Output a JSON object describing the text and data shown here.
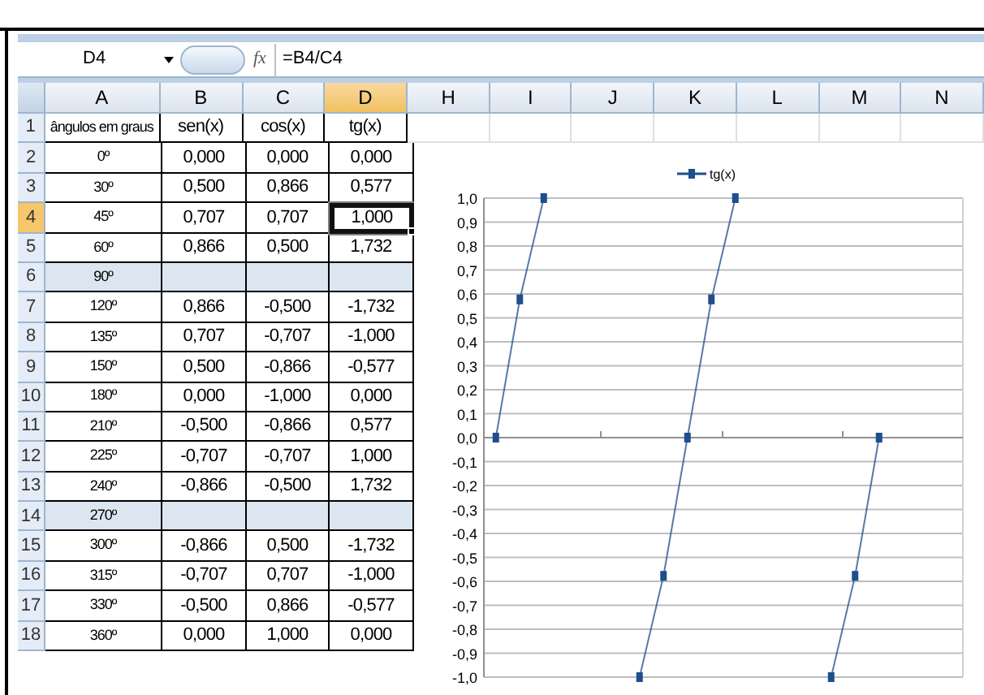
{
  "name_box": "D4",
  "fx_label": "fx",
  "formula": "=B4/C4",
  "columns": [
    {
      "label": "A",
      "selected": false
    },
    {
      "label": "B",
      "selected": false
    },
    {
      "label": "C",
      "selected": false
    },
    {
      "label": "D",
      "selected": true
    },
    {
      "label": "H",
      "selected": false
    },
    {
      "label": "I",
      "selected": false
    },
    {
      "label": "J",
      "selected": false
    },
    {
      "label": "K",
      "selected": false
    },
    {
      "label": "L",
      "selected": false
    },
    {
      "label": "M",
      "selected": false
    },
    {
      "label": "N",
      "selected": false
    }
  ],
  "rows": [
    {
      "number": "1",
      "selected": false,
      "shaded": false,
      "cells": [
        {
          "text": "ângulos em graus",
          "selected": false
        },
        {
          "text": "sen(x)",
          "selected": false
        },
        {
          "text": "cos(x)",
          "selected": false
        },
        {
          "text": "tg(x)",
          "selected": false
        }
      ]
    },
    {
      "number": "2",
      "selected": false,
      "shaded": false,
      "cells": [
        {
          "text": "0º",
          "selected": false
        },
        {
          "text": "0,000",
          "selected": false
        },
        {
          "text": "0,000",
          "selected": false
        },
        {
          "text": "0,000",
          "selected": false
        }
      ]
    },
    {
      "number": "3",
      "selected": false,
      "shaded": false,
      "cells": [
        {
          "text": "30º",
          "selected": false
        },
        {
          "text": "0,500",
          "selected": false
        },
        {
          "text": "0,866",
          "selected": false
        },
        {
          "text": "0,577",
          "selected": false
        }
      ]
    },
    {
      "number": "4",
      "selected": true,
      "shaded": false,
      "cells": [
        {
          "text": "45º",
          "selected": false
        },
        {
          "text": "0,707",
          "selected": false
        },
        {
          "text": "0,707",
          "selected": false
        },
        {
          "text": "1,000",
          "selected": true
        }
      ]
    },
    {
      "number": "5",
      "selected": false,
      "shaded": false,
      "cells": [
        {
          "text": "60º",
          "selected": false
        },
        {
          "text": "0,866",
          "selected": false
        },
        {
          "text": "0,500",
          "selected": false
        },
        {
          "text": "1,732",
          "selected": false
        }
      ]
    },
    {
      "number": "6",
      "selected": false,
      "shaded": true,
      "cells": [
        {
          "text": "90º",
          "selected": false
        }
      ]
    },
    {
      "number": "7",
      "selected": false,
      "shaded": false,
      "cells": [
        {
          "text": "120º",
          "selected": false
        },
        {
          "text": "0,866",
          "selected": false
        },
        {
          "text": "-0,500",
          "selected": false
        },
        {
          "text": "-1,732",
          "selected": false
        }
      ]
    },
    {
      "number": "8",
      "selected": false,
      "shaded": false,
      "cells": [
        {
          "text": "135º",
          "selected": false
        },
        {
          "text": "0,707",
          "selected": false
        },
        {
          "text": "-0,707",
          "selected": false
        },
        {
          "text": "-1,000",
          "selected": false
        }
      ]
    },
    {
      "number": "9",
      "selected": false,
      "shaded": false,
      "cells": [
        {
          "text": "150º",
          "selected": false
        },
        {
          "text": "0,500",
          "selected": false
        },
        {
          "text": "-0,866",
          "selected": false
        },
        {
          "text": "-0,577",
          "selected": false
        }
      ]
    },
    {
      "number": "10",
      "selected": false,
      "shaded": false,
      "cells": [
        {
          "text": "180º",
          "selected": false
        },
        {
          "text": "0,000",
          "selected": false
        },
        {
          "text": "-1,000",
          "selected": false
        },
        {
          "text": "0,000",
          "selected": false
        }
      ]
    },
    {
      "number": "11",
      "selected": false,
      "shaded": false,
      "cells": [
        {
          "text": "210º",
          "selected": false
        },
        {
          "text": "-0,500",
          "selected": false
        },
        {
          "text": "-0,866",
          "selected": false
        },
        {
          "text": "0,577",
          "selected": false
        }
      ]
    },
    {
      "number": "12",
      "selected": false,
      "shaded": false,
      "cells": [
        {
          "text": "225º",
          "selected": false
        },
        {
          "text": "-0,707",
          "selected": false
        },
        {
          "text": "-0,707",
          "selected": false
        },
        {
          "text": "1,000",
          "selected": false
        }
      ]
    },
    {
      "number": "13",
      "selected": false,
      "shaded": false,
      "cells": [
        {
          "text": "240º",
          "selected": false
        },
        {
          "text": "-0,866",
          "selected": false
        },
        {
          "text": "-0,500",
          "selected": false
        },
        {
          "text": "1,732",
          "selected": false
        }
      ]
    },
    {
      "number": "14",
      "selected": false,
      "shaded": true,
      "cells": [
        {
          "text": "270º",
          "selected": false
        }
      ]
    },
    {
      "number": "15",
      "selected": false,
      "shaded": false,
      "cells": [
        {
          "text": "300º",
          "selected": false
        },
        {
          "text": "-0,866",
          "selected": false
        },
        {
          "text": "0,500",
          "selected": false
        },
        {
          "text": "-1,732",
          "selected": false
        }
      ]
    },
    {
      "number": "16",
      "selected": false,
      "shaded": false,
      "cells": [
        {
          "text": "315º",
          "selected": false
        },
        {
          "text": "-0,707",
          "selected": false
        },
        {
          "text": "0,707",
          "selected": false
        },
        {
          "text": "-1,000",
          "selected": false
        }
      ]
    },
    {
      "number": "17",
      "selected": false,
      "shaded": false,
      "cells": [
        {
          "text": "330º",
          "selected": false
        },
        {
          "text": "-0,500",
          "selected": false
        },
        {
          "text": "0,866",
          "selected": false
        },
        {
          "text": "-0,577",
          "selected": false
        }
      ]
    },
    {
      "number": "18",
      "selected": false,
      "shaded": false,
      "cells": [
        {
          "text": "360º",
          "selected": false
        },
        {
          "text": "0,000",
          "selected": false
        },
        {
          "text": "1,000",
          "selected": false
        },
        {
          "text": "0,000",
          "selected": false
        }
      ]
    }
  ],
  "chart": {
    "chart_data": {
      "type": "line",
      "grid": true,
      "categories": [
        null,
        null,
        null,
        null,
        null,
        null,
        null,
        null,
        null,
        null,
        null,
        null,
        null,
        null,
        null,
        null,
        null,
        null,
        null,
        null
      ],
      "ylim": [
        -1,
        1
      ],
      "yticks": [
        {
          "value": 1,
          "label": "1,0"
        },
        {
          "value": 0.9,
          "label": "0,9"
        },
        {
          "value": 0.8,
          "label": "0,8"
        },
        {
          "value": 0.7,
          "label": "0,7"
        },
        {
          "value": 0.6,
          "label": "0,6"
        },
        {
          "value": 0.5,
          "label": "0,5"
        },
        {
          "value": 0.4,
          "label": "0,4"
        },
        {
          "value": 0.3,
          "label": "0,3"
        },
        {
          "value": 0.2,
          "label": "0,2"
        },
        {
          "value": 0.1,
          "label": "0,1"
        },
        {
          "value": 0,
          "label": "0,0"
        },
        {
          "value": -0.1,
          "label": "-0,1"
        },
        {
          "value": -0.2,
          "label": "-0,2"
        },
        {
          "value": -0.3,
          "label": "-0,3"
        },
        {
          "value": -0.4,
          "label": "-0,4"
        },
        {
          "value": -0.5,
          "label": "-0,5"
        },
        {
          "value": -0.6,
          "label": "-0,6"
        },
        {
          "value": -0.7,
          "label": "-0,7"
        },
        {
          "value": -0.8,
          "label": "-0,8"
        },
        {
          "value": -0.9,
          "label": "-0,9"
        },
        {
          "value": -1,
          "label": "-1,0"
        }
      ],
      "series": [
        {
          "name": "tg(x)",
          "color": "#1f4e8c",
          "marker": "square",
          "values": [
            0,
            0.577,
            1,
            null,
            null,
            null,
            -1,
            -0.577,
            0,
            0.577,
            1,
            null,
            null,
            null,
            -1,
            -0.577,
            0,
            null,
            null,
            null
          ]
        }
      ]
    }
  }
}
